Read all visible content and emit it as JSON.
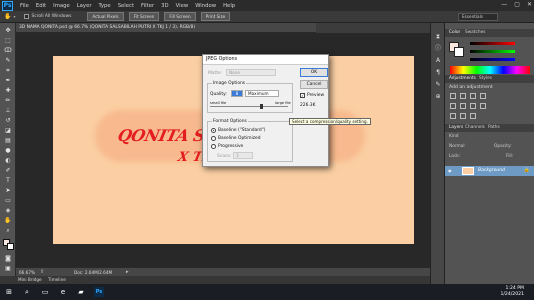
{
  "app": {
    "logo": "Ps",
    "menu": [
      "File",
      "Edit",
      "Image",
      "Layer",
      "Type",
      "Select",
      "Filter",
      "3D",
      "View",
      "Window",
      "Help"
    ],
    "window_controls": [
      "—",
      "▢",
      "✕"
    ]
  },
  "options_bar": {
    "scroll_all_windows": "Scroll All Windows",
    "buttons": [
      "Actual Pixels",
      "Fit Screen",
      "Fill Screen",
      "Print Size"
    ],
    "workspace": "Essentials"
  },
  "document": {
    "tab_title": "3D NAMA QONITA.psd @ 66.7% (QONITA SALSABILAH PUTRI        X TKJ 1 / 3), RGB/8)",
    "art_line1": "QONITA SALSABILAH",
    "art_line2": "X TKJ"
  },
  "status": {
    "zoom": "66.67%",
    "doc_info": "Doc: 2.64M/2.64M"
  },
  "bottom_tabs": [
    "Mini Bridge",
    "Timeline"
  ],
  "panels": {
    "color_tabs": [
      "Color",
      "Swatches"
    ],
    "adjust_tabs": [
      "Adjustments",
      "Styles"
    ],
    "add_adjustment": "Add an adjustment",
    "layer_tabs": [
      "Layers",
      "Channels",
      "Paths"
    ],
    "kind_label": "Kind",
    "blend_mode": "Normal",
    "opacity_label": "Opacity:",
    "lock_label": "Lock:",
    "fill_label": "Fill:",
    "layer_name": "Background"
  },
  "dialog": {
    "title": "JPEG Options",
    "matte_label": "Matte:",
    "matte_value": "None",
    "image_options_title": "Image Options",
    "quality_label": "Quality:",
    "quality_value": "8",
    "quality_preset": "Maximum",
    "small_file": "small file",
    "large_file": "large file",
    "quality_max": 12,
    "format_options_title": "Format Options",
    "format_options": [
      "Baseline (\"Standard\")",
      "Baseline Optimized",
      "Progressive"
    ],
    "selected_format": 0,
    "scans_label": "Scans:",
    "scans_value": "3",
    "ok_label": "OK",
    "cancel_label": "Cancel",
    "preview_label": "Preview",
    "preview_checked": true,
    "file_size": "226.3K"
  },
  "tooltip": "Select a compression/quality setting.",
  "taskbar": {
    "time": "1:24 PM",
    "date": "1/24/2021"
  }
}
